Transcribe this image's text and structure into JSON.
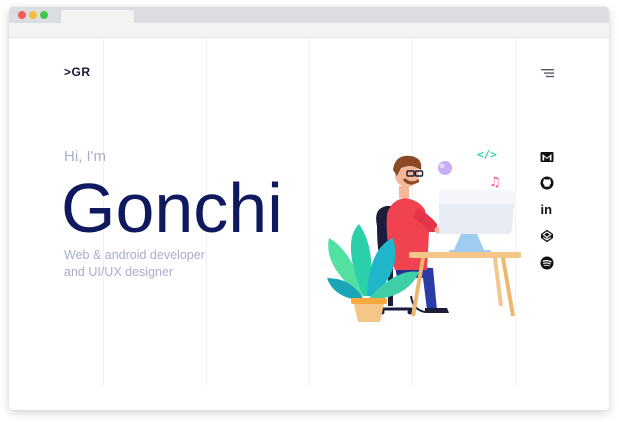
{
  "browser": {
    "tab_title": ""
  },
  "header": {
    "logo": ">GR",
    "menu_icon": "hamburger-menu-icon"
  },
  "hero": {
    "greeting": "Hi, I'm",
    "name": "Gonchi",
    "role_line1": "Web & android developer",
    "role_line2": "and UI/UX designer"
  },
  "illustration": {
    "icon_code": "</>",
    "icon_music": "♫"
  },
  "social": [
    {
      "name": "gmail",
      "icon": "gmail-icon"
    },
    {
      "name": "github",
      "icon": "github-icon"
    },
    {
      "name": "linkedin",
      "icon": "linkedin-icon",
      "text": "in"
    },
    {
      "name": "codepen",
      "icon": "codepen-icon"
    },
    {
      "name": "spotify",
      "icon": "spotify-icon"
    }
  ],
  "colors": {
    "primary": "#0f1a5e",
    "muted_text": "#a7aec9",
    "accent_red": "#f0424f",
    "accent_teal": "#2ad1a8",
    "desk": "#f4c689"
  }
}
